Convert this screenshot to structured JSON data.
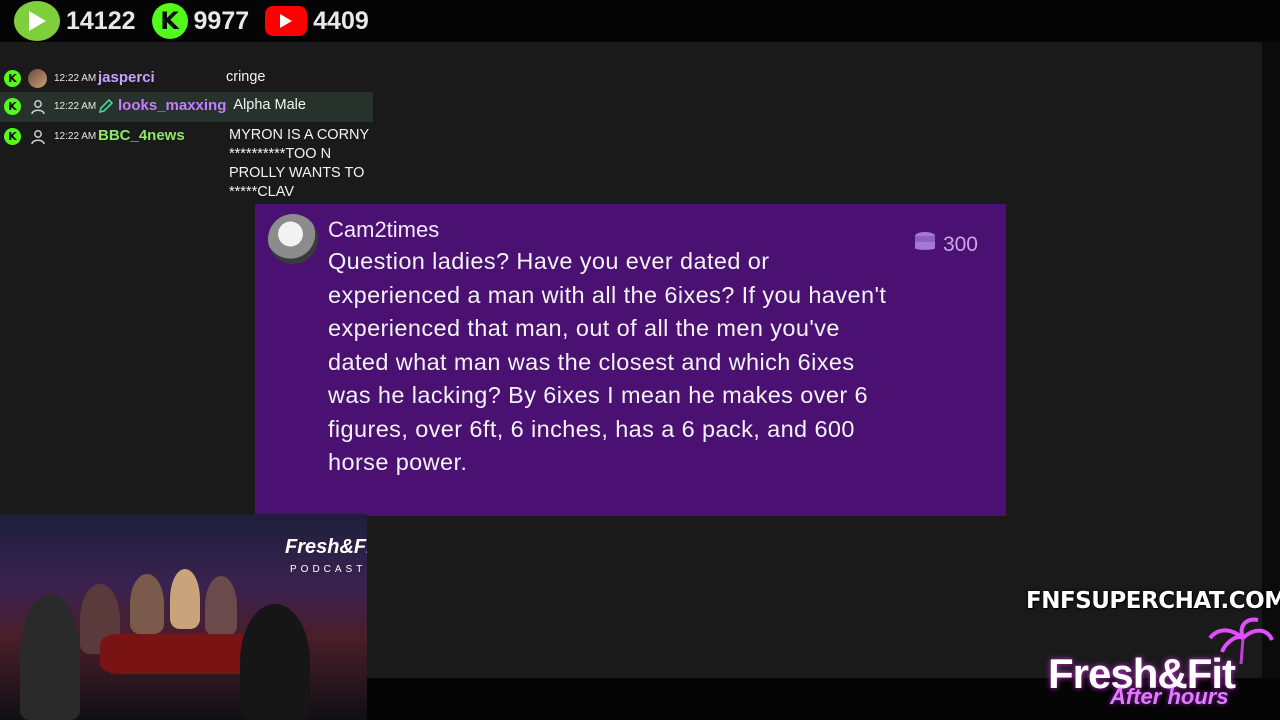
{
  "stats": {
    "rumble_count": "14122",
    "kick_count": "9977",
    "youtube_count": "4409"
  },
  "chat": {
    "messages": [
      {
        "time": "12:22 AM",
        "user": "jasperci",
        "user_color": "#c8a2ff",
        "text": "cringe"
      },
      {
        "time": "12:22 AM",
        "user": "looks_maxxing",
        "user_color": "#c57cff",
        "text": "Alpha Male"
      },
      {
        "time": "12:22 AM",
        "user": "BBC_4news",
        "user_color": "#8ee66a",
        "text": "MYRON IS A CORNY **********TOO N PROLLY WANTS TO *****CLAV"
      }
    ]
  },
  "superchat": {
    "username": "Cam2times",
    "amount": "300",
    "message": "Question ladies? Have you ever dated or experienced a man with all the 6ixes? If you haven't experienced that man, out of all the men you've dated what man was the closest and which 6ixes was he lacking? By 6ixes I mean he makes over 6 figures, over 6ft, 6 inches, has a 6 pack, and 600 horse power.",
    "bg_color": "#4a1072"
  },
  "camera": {
    "logo_text": "Fresh&Fit",
    "logo_sub": "PODCAST"
  },
  "watermark": {
    "url": "FNFSUPERCHAT.COM",
    "logo": "Fresh&Fit",
    "tagline": "After hours"
  }
}
